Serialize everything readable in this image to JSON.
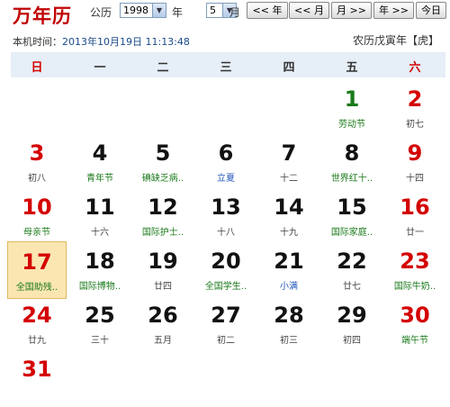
{
  "header": {
    "logo": "万年历",
    "calendar_label": "公历",
    "year_value": "1998",
    "year_label": "年",
    "month_value": "5",
    "month_label": "月",
    "prev_year_btn": "<< 年",
    "prev_month_btn": "<< 月",
    "next_month_btn": "月 >>",
    "next_year_btn": "年 >>",
    "today_btn": "今日",
    "now_label": "本机时间：",
    "now_value": "2013年10月19日 11:13:48",
    "lunar_year": "农历戊寅年【虎】"
  },
  "weekdays": [
    "日",
    "一",
    "二",
    "三",
    "四",
    "五",
    "六"
  ],
  "days": [
    {
      "num": "1",
      "sub": "劳动节",
      "col": 5,
      "row": 0,
      "numColor": "green",
      "subColor": "green"
    },
    {
      "num": "2",
      "sub": "初七",
      "col": 6,
      "row": 0,
      "numColor": "red",
      "subColor": ""
    },
    {
      "num": "3",
      "sub": "初八",
      "col": 0,
      "row": 1,
      "numColor": "red",
      "subColor": ""
    },
    {
      "num": "4",
      "sub": "青年节",
      "col": 1,
      "row": 1,
      "numColor": "",
      "subColor": "green"
    },
    {
      "num": "5",
      "sub": "碘缺乏病..",
      "col": 2,
      "row": 1,
      "numColor": "",
      "subColor": "green"
    },
    {
      "num": "6",
      "sub": "立夏",
      "col": 3,
      "row": 1,
      "numColor": "",
      "subColor": "blue"
    },
    {
      "num": "7",
      "sub": "十二",
      "col": 4,
      "row": 1,
      "numColor": "",
      "subColor": ""
    },
    {
      "num": "8",
      "sub": "世界红十..",
      "col": 5,
      "row": 1,
      "numColor": "",
      "subColor": "green"
    },
    {
      "num": "9",
      "sub": "十四",
      "col": 6,
      "row": 1,
      "numColor": "red",
      "subColor": ""
    },
    {
      "num": "10",
      "sub": "母亲节",
      "col": 0,
      "row": 2,
      "numColor": "red",
      "subColor": "green"
    },
    {
      "num": "11",
      "sub": "十六",
      "col": 1,
      "row": 2,
      "numColor": "",
      "subColor": ""
    },
    {
      "num": "12",
      "sub": "国际护士..",
      "col": 2,
      "row": 2,
      "numColor": "",
      "subColor": "green"
    },
    {
      "num": "13",
      "sub": "十八",
      "col": 3,
      "row": 2,
      "numColor": "",
      "subColor": ""
    },
    {
      "num": "14",
      "sub": "十九",
      "col": 4,
      "row": 2,
      "numColor": "",
      "subColor": ""
    },
    {
      "num": "15",
      "sub": "国际家庭..",
      "col": 5,
      "row": 2,
      "numColor": "",
      "subColor": "green"
    },
    {
      "num": "16",
      "sub": "廿一",
      "col": 6,
      "row": 2,
      "numColor": "red",
      "subColor": ""
    },
    {
      "num": "17",
      "sub": "全国助残..",
      "col": 0,
      "row": 3,
      "numColor": "red",
      "subColor": "green",
      "today": true
    },
    {
      "num": "18",
      "sub": "国际博物..",
      "col": 1,
      "row": 3,
      "numColor": "",
      "subColor": "green"
    },
    {
      "num": "19",
      "sub": "廿四",
      "col": 2,
      "row": 3,
      "numColor": "",
      "subColor": ""
    },
    {
      "num": "20",
      "sub": "全国学生..",
      "col": 3,
      "row": 3,
      "numColor": "",
      "subColor": "green"
    },
    {
      "num": "21",
      "sub": "小满",
      "col": 4,
      "row": 3,
      "numColor": "",
      "subColor": "blue"
    },
    {
      "num": "22",
      "sub": "廿七",
      "col": 5,
      "row": 3,
      "numColor": "",
      "subColor": ""
    },
    {
      "num": "23",
      "sub": "国际牛奶..",
      "col": 6,
      "row": 3,
      "numColor": "red",
      "subColor": "green"
    },
    {
      "num": "24",
      "sub": "廿九",
      "col": 0,
      "row": 4,
      "numColor": "red",
      "subColor": ""
    },
    {
      "num": "25",
      "sub": "三十",
      "col": 1,
      "row": 4,
      "numColor": "",
      "subColor": ""
    },
    {
      "num": "26",
      "sub": "五月",
      "col": 2,
      "row": 4,
      "numColor": "",
      "subColor": ""
    },
    {
      "num": "27",
      "sub": "初二",
      "col": 3,
      "row": 4,
      "numColor": "",
      "subColor": ""
    },
    {
      "num": "28",
      "sub": "初三",
      "col": 4,
      "row": 4,
      "numColor": "",
      "subColor": ""
    },
    {
      "num": "29",
      "sub": "初四",
      "col": 5,
      "row": 4,
      "numColor": "",
      "subColor": ""
    },
    {
      "num": "30",
      "sub": "端午节",
      "col": 6,
      "row": 4,
      "numColor": "red",
      "subColor": "green"
    },
    {
      "num": "31",
      "sub": "",
      "col": 0,
      "row": 5,
      "numColor": "red",
      "subColor": ""
    }
  ],
  "colors": {
    "red": "#d40000",
    "green": "#1a7a1a",
    "blue": "#2255bb",
    "weekbar": "#e6eef8",
    "today": "#fbe6b2"
  }
}
